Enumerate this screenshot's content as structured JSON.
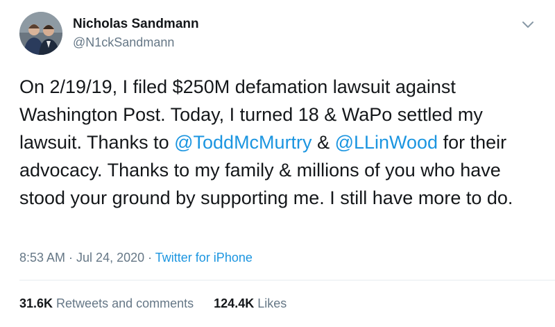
{
  "author": {
    "name": "Nicholas Sandmann",
    "handle": "@N1ckSandmann"
  },
  "tweet": {
    "text_1": "On 2/19/19, I filed $250M defamation lawsuit against Washington Post. Today, I turned 18 & WaPo settled my lawsuit. Thanks to ",
    "mention_1": "@ToddMcMurtry",
    "text_2": " & ",
    "mention_2": "@LLinWood",
    "text_3": " for their advocacy. Thanks to my family & millions of you who have stood your ground by supporting me. I still have more to do."
  },
  "meta": {
    "time": "8:53 AM",
    "separator": " · ",
    "date": "Jul 24, 2020",
    "separator_2": " · ",
    "source": "Twitter for iPhone"
  },
  "stats": {
    "retweets_count": "31.6K",
    "retweets_label": " Retweets and comments",
    "likes_count": "124.4K",
    "likes_label": " Likes"
  },
  "icons": {
    "menu": "chevron-down-icon"
  },
  "colors": {
    "link": "#1b95e0",
    "secondary": "#657786",
    "primary": "#14171a"
  }
}
